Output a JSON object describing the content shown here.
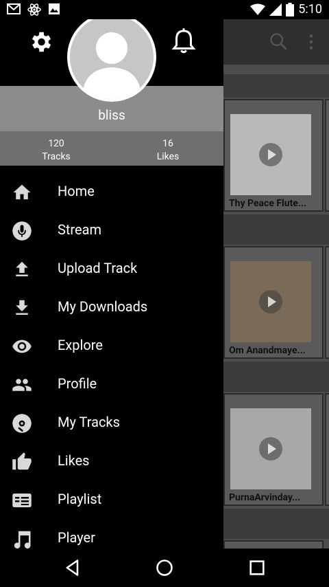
{
  "status_bar": {
    "time": "5:10",
    "left_icons": [
      "gmail-icon",
      "atom-icon",
      "image-icon"
    ],
    "right_icons": [
      "wifi-icon",
      "signal-icon",
      "battery-icon"
    ]
  },
  "drawer": {
    "user": {
      "name": "bliss",
      "tracks_count": "120",
      "tracks_label": "Tracks",
      "likes_count": "16",
      "likes_label": "Likes"
    },
    "menu": [
      {
        "label": "Home",
        "icon": "home-icon"
      },
      {
        "label": "Stream",
        "icon": "microphone-icon"
      },
      {
        "label": "Upload Track",
        "icon": "upload-icon"
      },
      {
        "label": "My Downloads",
        "icon": "download-icon"
      },
      {
        "label": "Explore",
        "icon": "eye-icon"
      },
      {
        "label": "Profile",
        "icon": "people-icon"
      },
      {
        "label": "My Tracks",
        "icon": "disc-icon"
      },
      {
        "label": "Likes",
        "icon": "thumbs-up-icon"
      },
      {
        "label": "Playlist",
        "icon": "playlist-icon"
      },
      {
        "label": "Player",
        "icon": "music-note-icon"
      }
    ]
  },
  "background": {
    "cards": [
      {
        "title": "Thy Peace Flute..."
      },
      {
        "title": "Om Anandmaye..."
      },
      {
        "title": "PurnaArvinday..."
      }
    ]
  },
  "nav_bar": {
    "buttons": [
      "back",
      "home",
      "recents"
    ]
  },
  "colors": {
    "drawer_bg": "#000000",
    "name_band": "#8c8c8c",
    "stats_band": "#6f6f6f",
    "icon_tint": "#d9d9d9"
  }
}
